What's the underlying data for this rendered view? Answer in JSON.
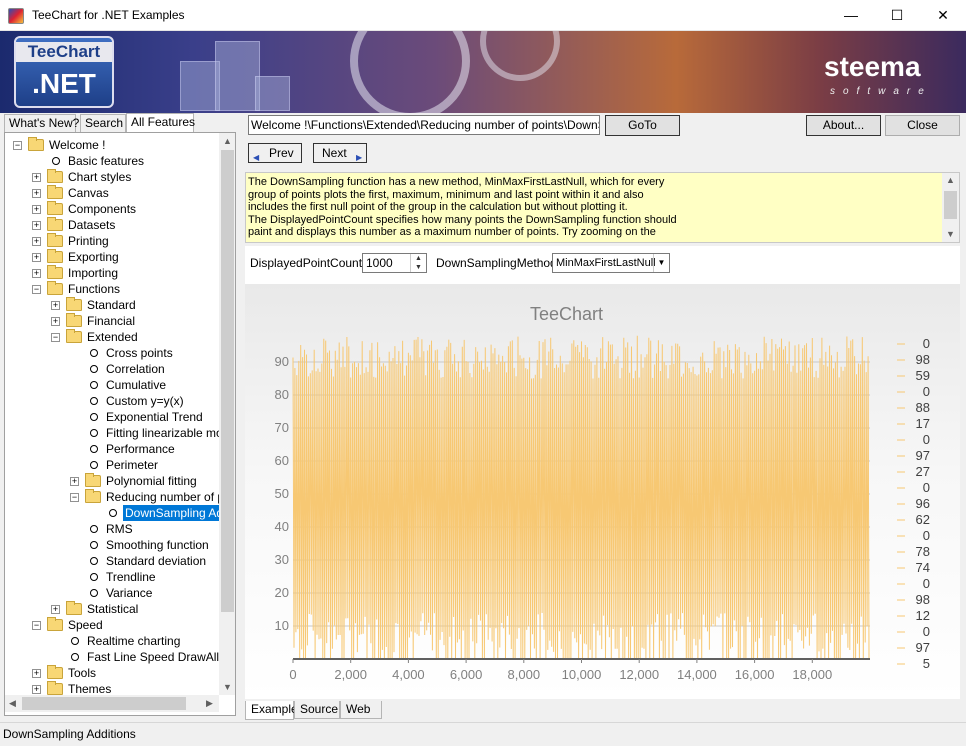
{
  "window": {
    "title": "TeeChart for .NET Examples",
    "minimize": "—",
    "maximize": "☐",
    "close": "✕"
  },
  "banner": {
    "logo_top": "TeeChart",
    "logo_bottom": ".NET",
    "brand": "steema",
    "brand_sub": "software"
  },
  "left_tabs": [
    "What's New?",
    "Search",
    "All Features"
  ],
  "tree": [
    {
      "label": "Welcome !",
      "level": 0,
      "type": "folder",
      "expander": "-"
    },
    {
      "label": "Basic features",
      "level": 1,
      "type": "leaf"
    },
    {
      "label": "Chart styles",
      "level": 1,
      "type": "folder",
      "expander": "+"
    },
    {
      "label": "Canvas",
      "level": 1,
      "type": "folder",
      "expander": "+"
    },
    {
      "label": "Components",
      "level": 1,
      "type": "folder",
      "expander": "+"
    },
    {
      "label": "Datasets",
      "level": 1,
      "type": "folder",
      "expander": "+"
    },
    {
      "label": "Printing",
      "level": 1,
      "type": "folder",
      "expander": "+"
    },
    {
      "label": "Exporting",
      "level": 1,
      "type": "folder",
      "expander": "+"
    },
    {
      "label": "Importing",
      "level": 1,
      "type": "folder",
      "expander": "+"
    },
    {
      "label": "Functions",
      "level": 1,
      "type": "folder",
      "expander": "-"
    },
    {
      "label": "Standard",
      "level": 2,
      "type": "folder",
      "expander": "+"
    },
    {
      "label": "Financial",
      "level": 2,
      "type": "folder",
      "expander": "+"
    },
    {
      "label": "Extended",
      "level": 2,
      "type": "folder",
      "expander": "-"
    },
    {
      "label": "Cross points",
      "level": 3,
      "type": "leaf"
    },
    {
      "label": "Correlation",
      "level": 3,
      "type": "leaf"
    },
    {
      "label": "Cumulative",
      "level": 3,
      "type": "leaf"
    },
    {
      "label": "Custom y=y(x)",
      "level": 3,
      "type": "leaf"
    },
    {
      "label": "Exponential Trend",
      "level": 3,
      "type": "leaf"
    },
    {
      "label": "Fitting linearizable model",
      "level": 3,
      "type": "leaf"
    },
    {
      "label": "Performance",
      "level": 3,
      "type": "leaf"
    },
    {
      "label": "Perimeter",
      "level": 3,
      "type": "leaf"
    },
    {
      "label": "Polynomial fitting",
      "level": 3,
      "type": "folder",
      "expander": "+"
    },
    {
      "label": "Reducing number of points",
      "level": 3,
      "type": "folder",
      "expander": "-"
    },
    {
      "label": "DownSampling Additions",
      "level": 4,
      "type": "leaf",
      "selected": true
    },
    {
      "label": "RMS",
      "level": 3,
      "type": "leaf"
    },
    {
      "label": "Smoothing function",
      "level": 3,
      "type": "leaf"
    },
    {
      "label": "Standard deviation",
      "level": 3,
      "type": "leaf"
    },
    {
      "label": "Trendline",
      "level": 3,
      "type": "leaf"
    },
    {
      "label": "Variance",
      "level": 3,
      "type": "leaf"
    },
    {
      "label": "Statistical",
      "level": 2,
      "type": "folder",
      "expander": "+"
    },
    {
      "label": "Speed",
      "level": 1,
      "type": "folder",
      "expander": "-"
    },
    {
      "label": "Realtime charting",
      "level": 2,
      "type": "leaf"
    },
    {
      "label": "Fast Line Speed DrawAll",
      "level": 2,
      "type": "leaf"
    },
    {
      "label": "Tools",
      "level": 1,
      "type": "folder",
      "expander": "+"
    },
    {
      "label": "Themes",
      "level": 1,
      "type": "folder",
      "expander": "+"
    }
  ],
  "toolbar": {
    "path": "Welcome !\\Functions\\Extended\\Reducing number of points\\DownSampling Additions",
    "goto": "GoTo",
    "about": "About...",
    "close": "Close",
    "prev": "Prev",
    "next": "Next"
  },
  "description": "The DownSampling function has a new method, MinMaxFirstLastNull, which for every\ngroup of points plots the first, maximum, minimum and last point within it and also\nincludes the first null point of the group in the calculation but without plotting it.\nThe DisplayedPointCount specifies how many points the DownSampling function should\npaint and displays this number as a maximum number of points. Try zooming on the",
  "controls": {
    "dpc_label": "DisplayedPointCount:",
    "dpc_value": "1000",
    "dsm_label": "DownSamplingMethod:",
    "dsm_value": "MinMaxFirstLastNull"
  },
  "chart_data": {
    "type": "line",
    "title": "TeeChart",
    "series_color": "#f7c873",
    "ylim": [
      0,
      100
    ],
    "xlim": [
      0,
      20000
    ],
    "y_ticks": [
      10,
      20,
      30,
      40,
      50,
      60,
      70,
      80,
      90
    ],
    "x_ticks": [
      0,
      2000,
      4000,
      6000,
      8000,
      10000,
      12000,
      14000,
      16000,
      18000
    ],
    "x_tick_labels": [
      "0",
      "2,000",
      "4,000",
      "6,000",
      "8,000",
      "10,000",
      "12,000",
      "14,000",
      "16,000",
      "18,000"
    ],
    "legend": [
      "0",
      "98",
      "59",
      "0",
      "88",
      "17",
      "0",
      "97",
      "27",
      "0",
      "96",
      "62",
      "0",
      "78",
      "74",
      "0",
      "98",
      "12",
      "0",
      "97",
      "5"
    ],
    "legend_position": "right",
    "grid": true
  },
  "bottom_tabs": [
    "Example",
    "Source",
    "Web"
  ],
  "status": "DownSampling Additions"
}
